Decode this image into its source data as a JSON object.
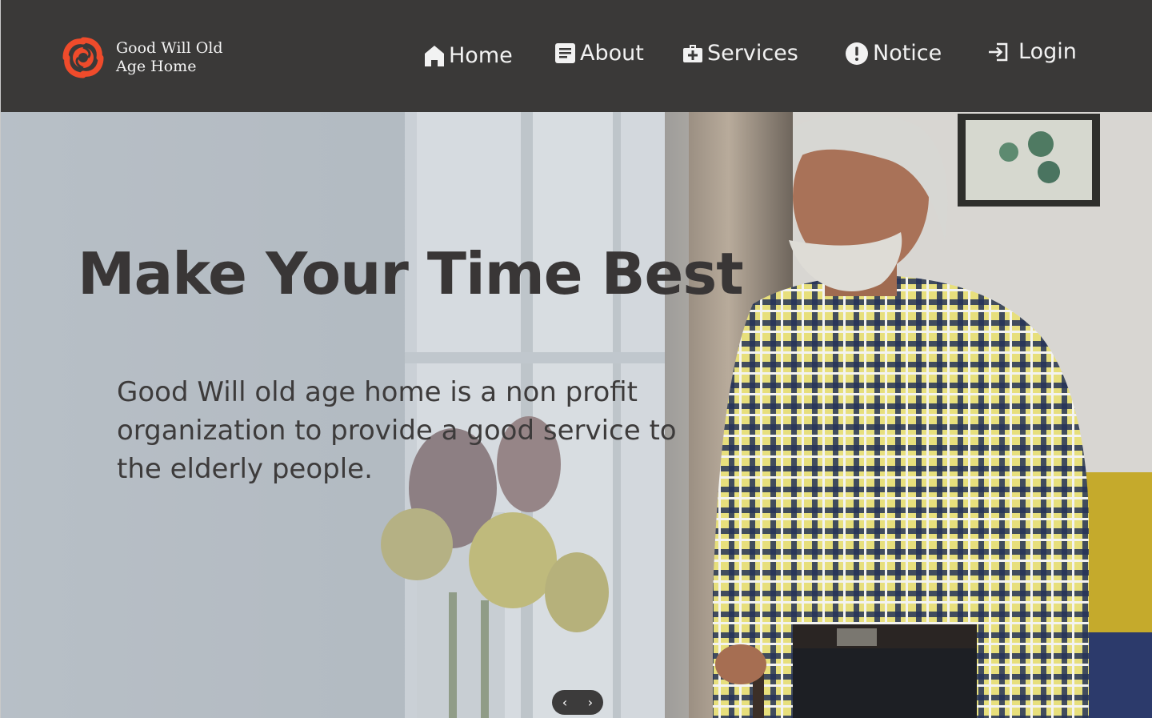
{
  "brand": {
    "name": "Good Will Old Age Home",
    "logo_color": "#ef4b2b"
  },
  "nav": {
    "home": "Home",
    "about": "About",
    "services": "Services",
    "notice": "Notice",
    "login": "Login"
  },
  "hero": {
    "title": "Make Your Time Best",
    "description": "Good Will old age home is a non profit organization to provide a good service to the elderly people."
  },
  "carousel": {
    "prev": "‹",
    "next": "›"
  },
  "icons": {
    "home": "home-icon",
    "about": "article-icon",
    "services": "medical-bag-icon",
    "notice": "alert-circle-icon",
    "login": "login-icon"
  },
  "colors": {
    "navbar": "#3a3938",
    "nav_text": "#f2f2f2",
    "hero_text": "#393636"
  }
}
